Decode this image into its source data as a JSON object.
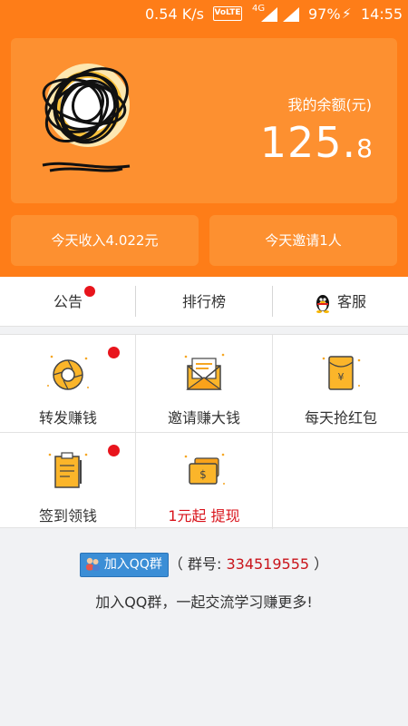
{
  "status_bar": {
    "speed": "0.54 K/s",
    "volte": "VoLTE",
    "network": "4G",
    "battery": "97%",
    "time": "14:55"
  },
  "account": {
    "balance_label": "我的余额(元)",
    "balance_int": "125.",
    "balance_dec": "8",
    "today_income": "今天收入4.022元",
    "today_invite": "今天邀请1人"
  },
  "tabs": [
    {
      "label": "公告",
      "badge": true
    },
    {
      "label": "排行榜",
      "badge": false
    },
    {
      "label": "客服",
      "icon": "qq-penguin-icon"
    }
  ],
  "grid": [
    {
      "label": "转发赚钱",
      "icon": "aperture-icon",
      "badge": true
    },
    {
      "label": "邀请赚大钱",
      "icon": "envelope-icon",
      "badge": false
    },
    {
      "label": "每天抢红包",
      "icon": "red-packet-icon",
      "badge": false
    },
    {
      "label": "签到领钱",
      "icon": "clipboard-icon",
      "badge": true
    },
    {
      "label": "1元起 提现",
      "icon": "cash-icon",
      "badge": false,
      "highlight": true
    }
  ],
  "qq_group": {
    "button_label": "加入QQ群",
    "open_paren": "（",
    "prefix": " 群号: ",
    "number": "334519555",
    "close_paren": " ）",
    "tip": "加入QQ群，一起交流学习赚更多!"
  },
  "colors": {
    "brand_orange": "#fe7d18",
    "card_orange": "#fd9030",
    "badge_red": "#e8141c",
    "highlight_red": "#d9131b"
  }
}
